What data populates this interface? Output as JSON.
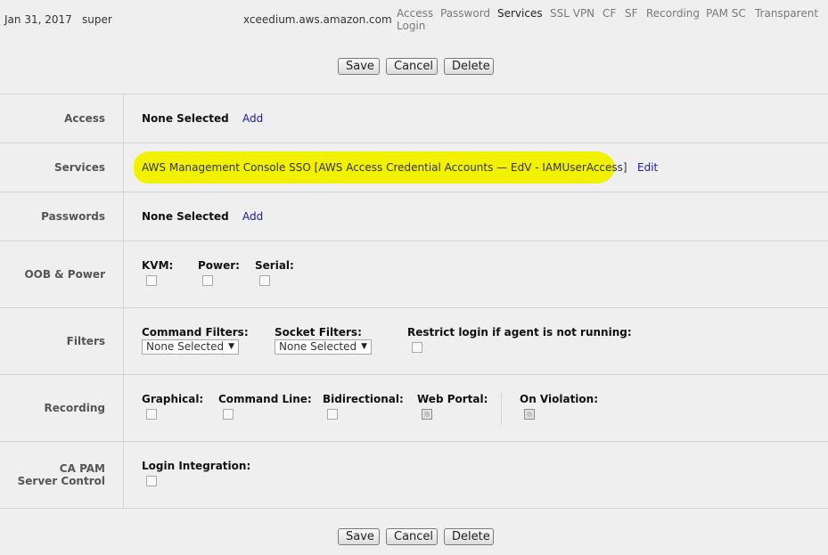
{
  "header": {
    "date": "Jan 31, 2017",
    "user": "super",
    "host": "xceedium.aws.amazon.com",
    "nav": [
      {
        "label": "Access"
      },
      {
        "label": "Password"
      },
      {
        "label": "Services",
        "active": true
      },
      {
        "label": "SSL VPN"
      },
      {
        "label": "CF"
      },
      {
        "label": "SF"
      },
      {
        "label": "Recording"
      },
      {
        "label": "PAM SC"
      },
      {
        "label": "Transparent"
      },
      {
        "label": "Login"
      }
    ]
  },
  "buttons": {
    "save": "Save",
    "cancel": "Cancel",
    "delete": "Delete"
  },
  "rows": {
    "access": {
      "label": "Access",
      "value": "None Selected",
      "action": "Add"
    },
    "services": {
      "label": "Services",
      "value": "AWS Management Console SSO [AWS Access Credential Accounts — EdV - IAMUserAccess]",
      "action": "Edit",
      "highlight_color": "#f2f200"
    },
    "passwords": {
      "label": "Passwords",
      "value": "None Selected",
      "action": "Add"
    },
    "oob": {
      "label": "OOB & Power",
      "kvm": "KVM:",
      "power": "Power:",
      "serial": "Serial:"
    },
    "filters": {
      "label": "Filters",
      "command_filters": "Command Filters:",
      "command_filters_value": "None Selected",
      "socket_filters": "Socket Filters:",
      "socket_filters_value": "None Selected",
      "restrict": "Restrict login if agent is not running:"
    },
    "recording": {
      "label": "Recording",
      "graphical": "Graphical:",
      "command_line": "Command Line:",
      "bidirectional": "Bidirectional:",
      "web_portal": "Web Portal:",
      "on_violation": "On Violation:"
    },
    "capam": {
      "label_line1": "CA PAM",
      "label_line2": "Server Control",
      "login_integration": "Login Integration:"
    }
  }
}
